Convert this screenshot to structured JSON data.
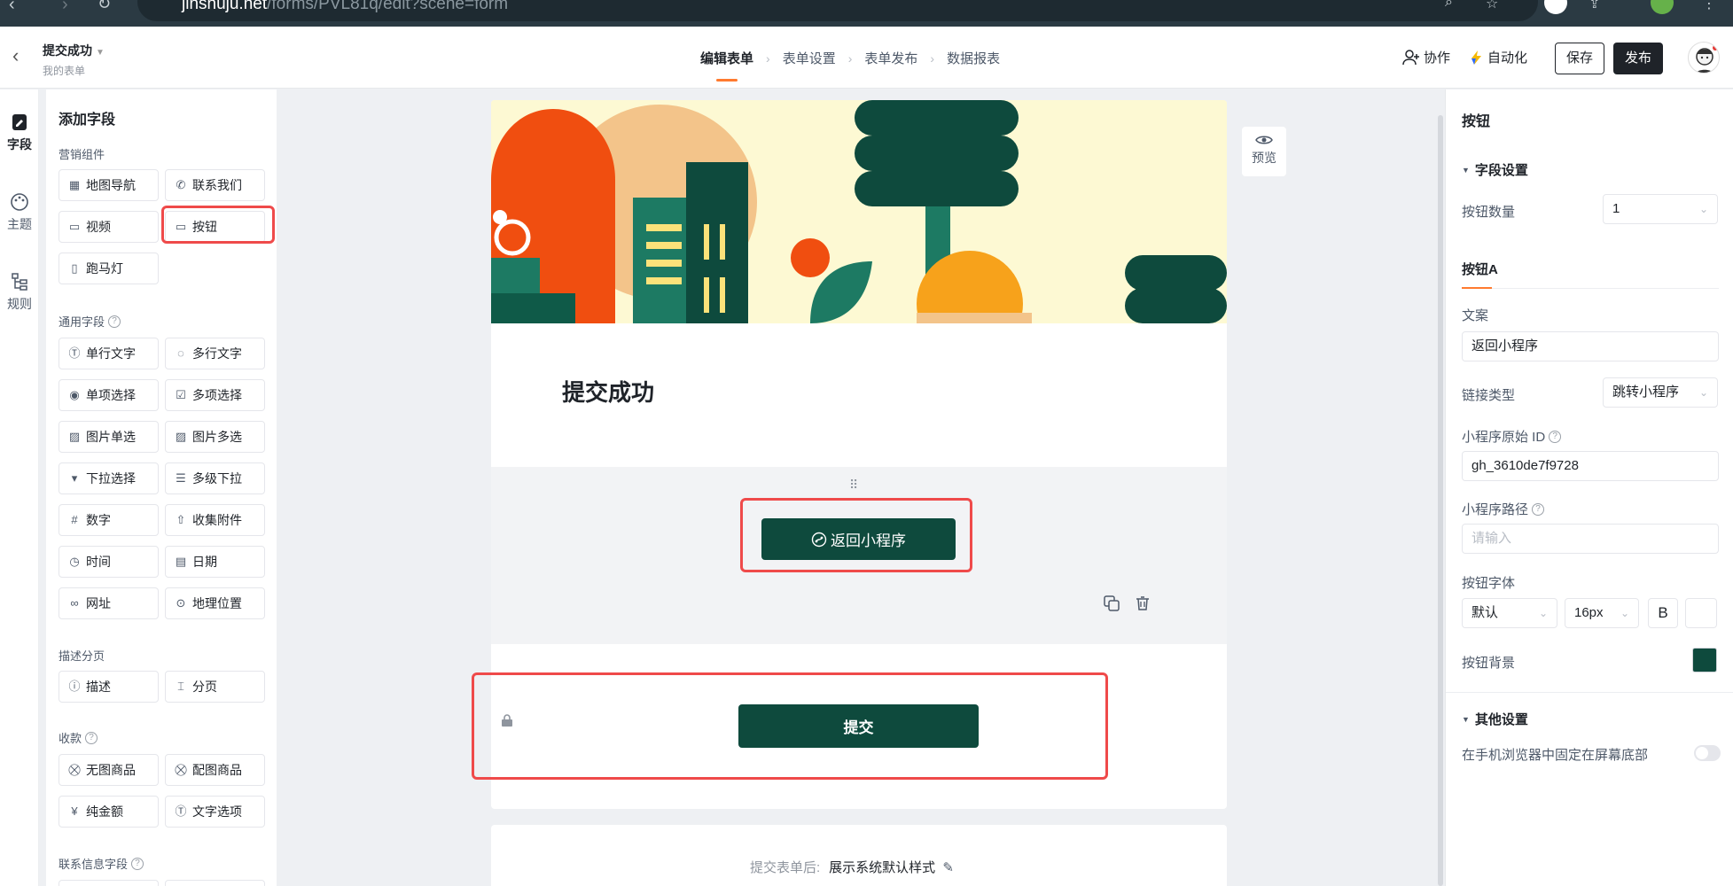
{
  "browser": {
    "url_host": "jinshuju.net",
    "url_path": "/forms/PVL81q/edit?scene=form"
  },
  "header": {
    "form_title": "提交成功",
    "form_subtitle": "我的表单",
    "steps": [
      "编辑表单",
      "表单设置",
      "表单发布",
      "数据报表"
    ],
    "collab_label": "协作",
    "automation_label": "自动化",
    "save_label": "保存",
    "publish_label": "发布"
  },
  "rail": {
    "items": [
      "字段",
      "主题",
      "规则"
    ]
  },
  "fields_panel": {
    "title": "添加字段",
    "groups": {
      "marketing": "营销组件",
      "common": "通用字段",
      "desc": "描述分页",
      "payment": "收款",
      "contact": "联系信息字段"
    },
    "marketing_items": [
      "地图导航",
      "联系我们",
      "视频",
      "按钮",
      "跑马灯"
    ],
    "common_items": [
      "单行文字",
      "多行文字",
      "单项选择",
      "多项选择",
      "图片单选",
      "图片多选",
      "下拉选择",
      "多级下拉",
      "数字",
      "收集附件",
      "时间",
      "日期",
      "网址",
      "地理位置"
    ],
    "desc_items": [
      "描述",
      "分页"
    ],
    "payment_items": [
      "无图商品",
      "配图商品",
      "纯金额",
      "文字选项"
    ]
  },
  "canvas": {
    "success_title": "提交成功",
    "mini_button_label": "返回小程序",
    "submit_label": "提交",
    "after_submit_label": "提交表单后:",
    "after_submit_value": "展示系统默认样式",
    "preview_label": "预览"
  },
  "right_panel": {
    "title": "按钮",
    "field_settings": "字段设置",
    "button_count_label": "按钮数量",
    "button_count_value": "1",
    "tab_a": "按钮A",
    "copy_label": "文案",
    "copy_value": "返回小程序",
    "link_type_label": "链接类型",
    "link_type_value": "跳转小程序",
    "mini_id_label": "小程序原始 ID",
    "mini_id_value": "gh_3610de7f9728",
    "mini_path_label": "小程序路径",
    "mini_path_placeholder": "请输入",
    "font_label": "按钮字体",
    "font_family_value": "默认",
    "font_size_value": "16px",
    "bold_label": "B",
    "bg_label": "按钮背景",
    "bg_color": "#0e4a3d",
    "other_settings": "其他设置",
    "fixed_bottom_label": "在手机浏览器中固定在屏幕底部"
  },
  "colors": {
    "accent": "#ff7a2f",
    "dark_green": "#0e4a3d",
    "highlight": "#ef4a4a"
  }
}
